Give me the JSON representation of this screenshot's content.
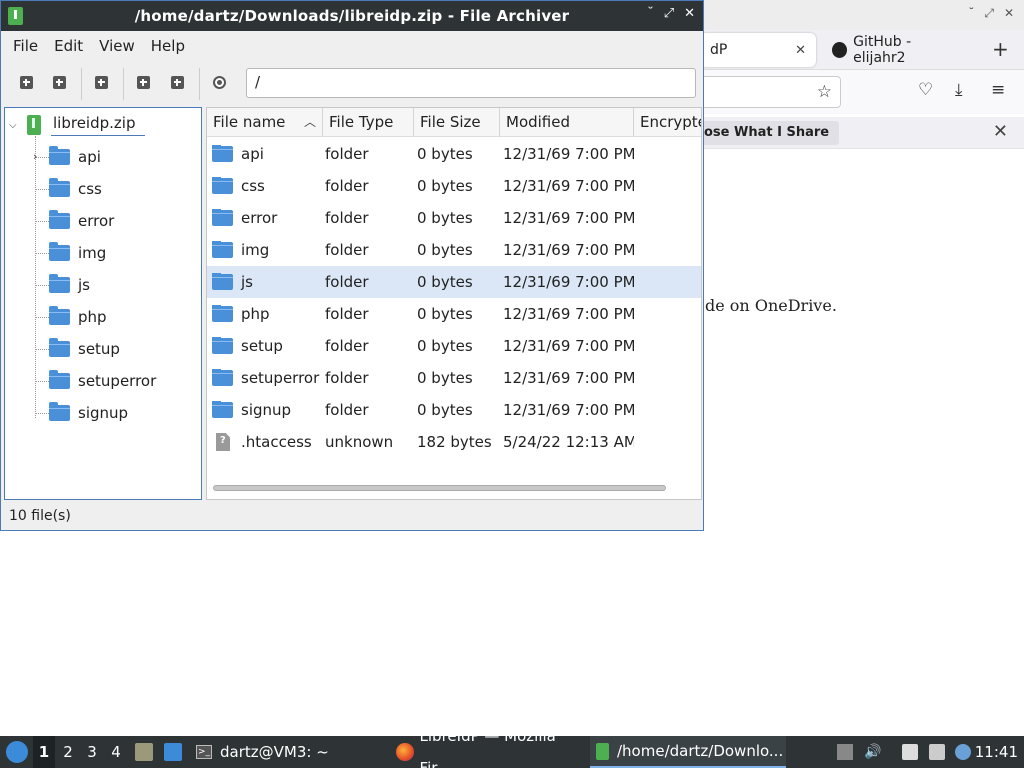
{
  "browser": {
    "tabs": [
      {
        "label": "dP",
        "close": "✕"
      },
      {
        "label": "GitHub - elijahr2",
        "close": ""
      }
    ],
    "new_tab": "+",
    "notification": {
      "button": "ose What I Share",
      "close": "✕"
    },
    "content_text": "de on OneDrive."
  },
  "archiver": {
    "title": "/home/dartz/Downloads/libreidp.zip - File Archiver",
    "window_buttons": {
      "minimize": "˘",
      "maximize": "⤢",
      "close": "✕"
    },
    "menu": [
      "File",
      "Edit",
      "View",
      "Help"
    ],
    "path": "/",
    "tree": {
      "root": "libreidp.zip",
      "items": [
        "api",
        "css",
        "error",
        "img",
        "js",
        "php",
        "setup",
        "setuperror",
        "signup"
      ]
    },
    "columns": [
      "File name",
      "File Type",
      "File Size",
      "Modified",
      "Encrypte"
    ],
    "rows": [
      {
        "name": "api",
        "type": "folder",
        "size": "0 bytes",
        "modified": "12/31/69 7:00 PM",
        "icon": "folder-icon"
      },
      {
        "name": "css",
        "type": "folder",
        "size": "0 bytes",
        "modified": "12/31/69 7:00 PM",
        "icon": "folder-icon"
      },
      {
        "name": "error",
        "type": "folder",
        "size": "0 bytes",
        "modified": "12/31/69 7:00 PM",
        "icon": "folder-icon"
      },
      {
        "name": "img",
        "type": "folder",
        "size": "0 bytes",
        "modified": "12/31/69 7:00 PM",
        "icon": "folder-icon"
      },
      {
        "name": "js",
        "type": "folder",
        "size": "0 bytes",
        "modified": "12/31/69 7:00 PM",
        "icon": "folder-icon"
      },
      {
        "name": "php",
        "type": "folder",
        "size": "0 bytes",
        "modified": "12/31/69 7:00 PM",
        "icon": "folder-icon"
      },
      {
        "name": "setup",
        "type": "folder",
        "size": "0 bytes",
        "modified": "12/31/69 7:00 PM",
        "icon": "folder-icon"
      },
      {
        "name": "setuperror",
        "type": "folder",
        "size": "0 bytes",
        "modified": "12/31/69 7:00 PM",
        "icon": "folder-icon"
      },
      {
        "name": "signup",
        "type": "folder",
        "size": "0 bytes",
        "modified": "12/31/69 7:00 PM",
        "icon": "folder-icon"
      },
      {
        "name": ".htaccess",
        "type": "unknown",
        "size": "182 bytes",
        "modified": "5/24/22 12:13 AM",
        "icon": "unknown-file-icon"
      }
    ],
    "selected_row": "js",
    "status": "10 file(s)"
  },
  "taskbar": {
    "workspaces": [
      "1",
      "2",
      "3",
      "4"
    ],
    "active_workspace": "1",
    "tasks": [
      {
        "label": "dartz@VM3: ~",
        "icon": "terminal-icon"
      },
      {
        "label": "LibreIdP — Mozilla Fir...",
        "icon": "firefox-icon"
      },
      {
        "label": "/home/dartz/Downlo...",
        "icon": "archiver-icon"
      }
    ],
    "clock": "11:41"
  }
}
